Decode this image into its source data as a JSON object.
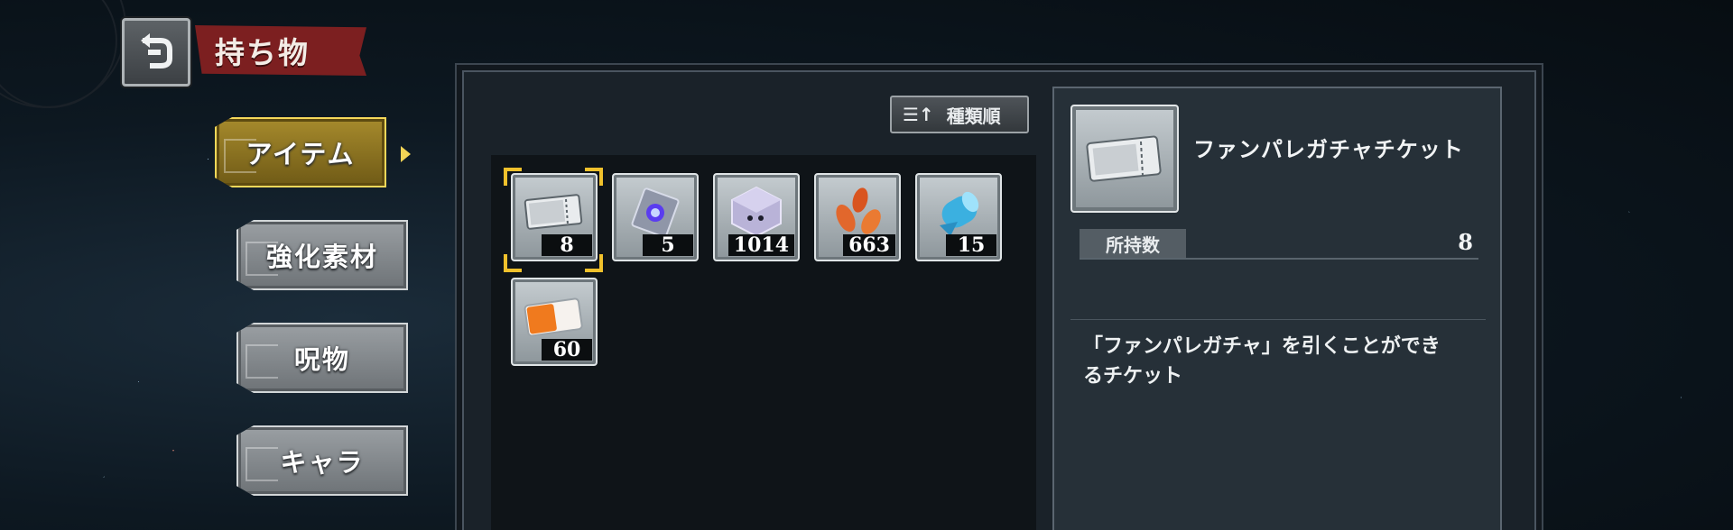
{
  "header": {
    "title": "持ち物"
  },
  "tabs": [
    {
      "label": "アイテム",
      "active": true
    },
    {
      "label": "強化素材",
      "active": false
    },
    {
      "label": "呪物",
      "active": false
    },
    {
      "label": "キャラ",
      "active": false
    }
  ],
  "sort": {
    "label": "種類順"
  },
  "items": [
    {
      "name": "ticket-icon",
      "count": "8",
      "selected": true
    },
    {
      "name": "crystal-card-icon",
      "count": "5",
      "selected": false
    },
    {
      "name": "gem-cube-icon",
      "count": "1014",
      "selected": false
    },
    {
      "name": "petals-icon",
      "count": "663",
      "selected": false
    },
    {
      "name": "scroll-icon",
      "count": "15",
      "selected": false
    },
    {
      "name": "orange-ticket-icon",
      "count": "60",
      "selected": false
    }
  ],
  "detail": {
    "name": "ファンパレガチャチケット",
    "owned_label": "所持数",
    "owned_value": "8",
    "description_line1": "「ファンパレガチャ」を引くことができ",
    "description_line2": "るチケット"
  },
  "colors": {
    "title_red": "#7c1f20",
    "active_gold": "#f2d456",
    "selection_gold": "#f0c12c"
  }
}
